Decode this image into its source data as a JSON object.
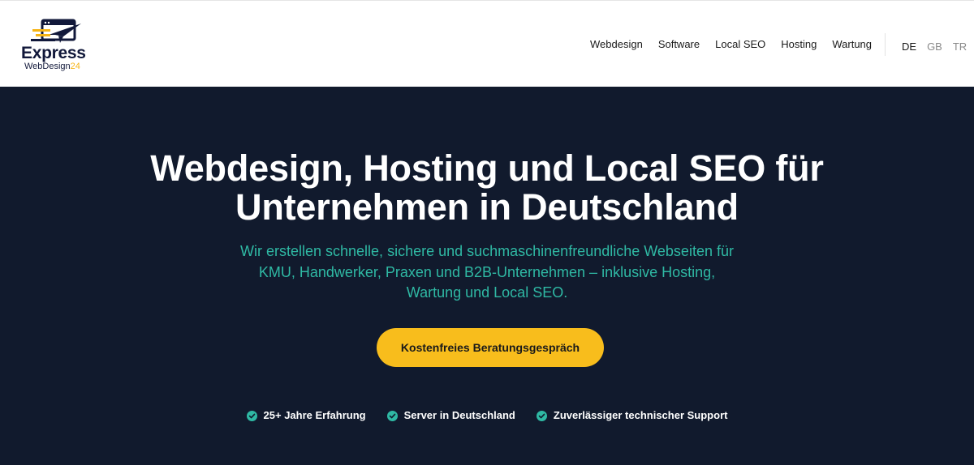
{
  "logo": {
    "title": "Express",
    "sub_text": "WebDesign",
    "sub_number": "24"
  },
  "nav": {
    "items": [
      {
        "label": "Webdesign"
      },
      {
        "label": "Software"
      },
      {
        "label": "Local SEO"
      },
      {
        "label": "Hosting"
      },
      {
        "label": "Wartung"
      }
    ]
  },
  "languages": {
    "active": "DE",
    "items": [
      {
        "label": "DE"
      },
      {
        "label": "GB"
      },
      {
        "label": "TR"
      }
    ]
  },
  "hero": {
    "title_lines": [
      "Webdesign, Hosting und Local SEO für",
      "Unternehmen in Deutschland"
    ],
    "subtitle_lines": [
      "Wir erstellen schnelle, sichere und suchmaschinenfreundliche Webseiten für",
      "KMU, Handwerker, Praxen und B2B-Unternehmen – inklusive Hosting,",
      "Wartung und Local SEO."
    ],
    "cta_label": "Kostenfreies Beratungsgespräch",
    "features": [
      {
        "icon": "check-circle-icon",
        "label": "25+ Jahre Erfahrung"
      },
      {
        "icon": "check-circle-icon",
        "label": "Server in Deutschland"
      },
      {
        "icon": "check-circle-icon",
        "label": "Zuverlässiger technischer Support"
      }
    ]
  },
  "colors": {
    "hero_background": "#111a2d",
    "accent_teal": "#2fb9a4",
    "cta_yellow": "#f8bd1c",
    "navy": "#11183a"
  }
}
